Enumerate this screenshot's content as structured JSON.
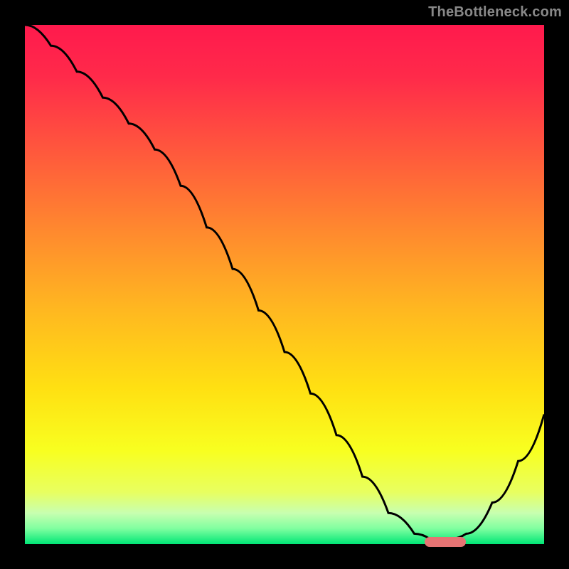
{
  "watermark": "TheBottleneck.com",
  "colors": {
    "gradient_top": "#ff1a4d",
    "gradient_mid": "#ffe012",
    "gradient_bottom": "#00e676",
    "curve": "#000000",
    "pill": "#e57373",
    "frame": "#000000",
    "watermark_text": "#888888"
  },
  "chart_data": {
    "type": "line",
    "title": "",
    "xlabel": "",
    "ylabel": "",
    "xlim": [
      0,
      100
    ],
    "ylim": [
      0,
      100
    ],
    "x": [
      0,
      5,
      10,
      15,
      20,
      25,
      30,
      35,
      40,
      45,
      50,
      55,
      60,
      65,
      70,
      75,
      78,
      80,
      82,
      85,
      90,
      95,
      100
    ],
    "values": [
      100,
      96,
      91,
      86,
      81,
      76,
      69,
      61,
      53,
      45,
      37,
      29,
      21,
      13,
      6,
      2,
      1,
      1,
      1,
      2,
      8,
      16,
      25
    ],
    "marker": {
      "x_start": 77,
      "x_end": 85,
      "y": 0
    },
    "grid": false,
    "legend": false
  }
}
